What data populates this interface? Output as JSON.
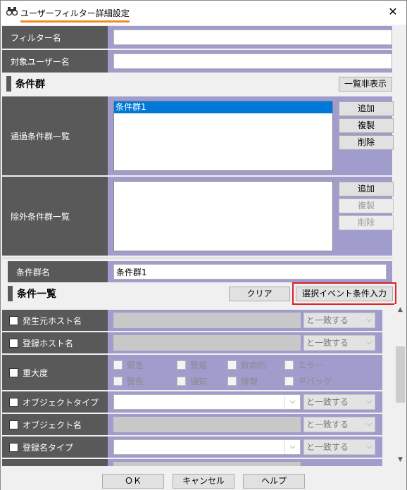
{
  "window": {
    "title": "ユーザーフィルター詳細設定",
    "title_icon": "binoculars-icon",
    "close_glyph": "✕"
  },
  "filter_name": {
    "label": "フィルター名",
    "value": ""
  },
  "target_user": {
    "label": "対象ユーザー名",
    "value": ""
  },
  "condition_groups": {
    "section_title": "条件群",
    "toggle_button": "一覧非表示"
  },
  "pass_groups": {
    "label": "通過条件群一覧",
    "items": [
      "条件群1"
    ],
    "buttons": {
      "add": "追加",
      "copy": "複製",
      "delete": "削除"
    }
  },
  "exclude_groups": {
    "label": "除外条件群一覧",
    "items": [],
    "buttons": {
      "add": "追加",
      "copy": "複製",
      "delete": "削除"
    }
  },
  "group_name": {
    "label": "条件群名",
    "value": "条件群1"
  },
  "conditions": {
    "section_title": "条件一覧",
    "clear_button": "クリア",
    "import_button": "選択イベント条件入力",
    "rows": [
      {
        "label": "発生元ホスト名",
        "match": "と一致する"
      },
      {
        "label": "登録ホスト名",
        "match": "と一致する"
      },
      {
        "label": "重大度"
      },
      {
        "label": "オブジェクトタイプ",
        "match": "と一致する"
      },
      {
        "label": "オブジェクト名",
        "match": "と一致する"
      },
      {
        "label": "登録名タイプ",
        "match": "と一致する"
      }
    ],
    "severity": [
      "緊急",
      "警戒",
      "致命的",
      "エラー",
      "警告",
      "通知",
      "情報",
      "デバッグ"
    ]
  },
  "footer": {
    "ok": "ＯＫ",
    "cancel": "キャンセル",
    "help": "ヘルプ"
  },
  "colors": {
    "label_bg": "#595959",
    "value_bg": "#a09ccc",
    "highlight": "#e0202a",
    "title_underline": "#f08a24"
  }
}
